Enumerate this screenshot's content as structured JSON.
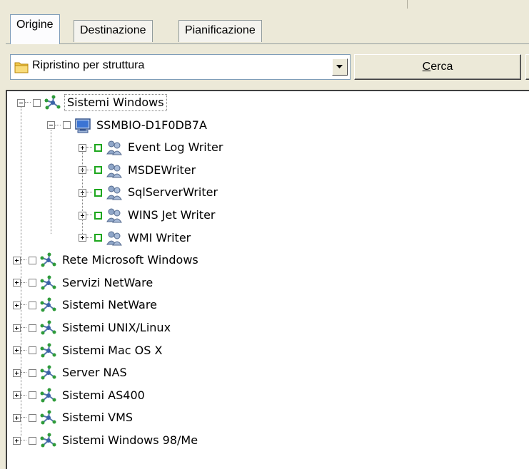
{
  "tabs": [
    "Origine",
    "Destinazione",
    "Pianificazione"
  ],
  "active_tab": "Origine",
  "view_select": {
    "value": "Ripristino per struttura"
  },
  "search_button": {
    "label": "Cerca",
    "accelerator": "C"
  },
  "tree": {
    "root": {
      "label": "Sistemi Windows",
      "expanded": true,
      "selected": true
    },
    "computer": {
      "label": "SSMBIO-D1F0DB7A",
      "expanded": true
    },
    "writers": [
      {
        "label": "Event Log Writer"
      },
      {
        "label": "MSDEWriter"
      },
      {
        "label": "SqlServerWriter"
      },
      {
        "label": "WINS Jet Writer"
      },
      {
        "label": "WMI Writer"
      }
    ],
    "networks": [
      {
        "label": "Rete Microsoft Windows"
      },
      {
        "label": "Servizi NetWare"
      },
      {
        "label": "Sistemi NetWare"
      },
      {
        "label": "Sistemi UNIX/Linux"
      },
      {
        "label": "Sistemi Mac OS X"
      },
      {
        "label": "Server NAS"
      },
      {
        "label": "Sistemi AS400"
      },
      {
        "label": "Sistemi VMS"
      },
      {
        "label": "Sistemi Windows 98/Me"
      }
    ]
  },
  "colors": {
    "check_green": "#1ea71e",
    "tab_border": "#919b9c"
  },
  "icons": {
    "network": "network-icon",
    "computer": "computer-icon",
    "writer": "writer-icon",
    "folder": "folder-icon"
  }
}
